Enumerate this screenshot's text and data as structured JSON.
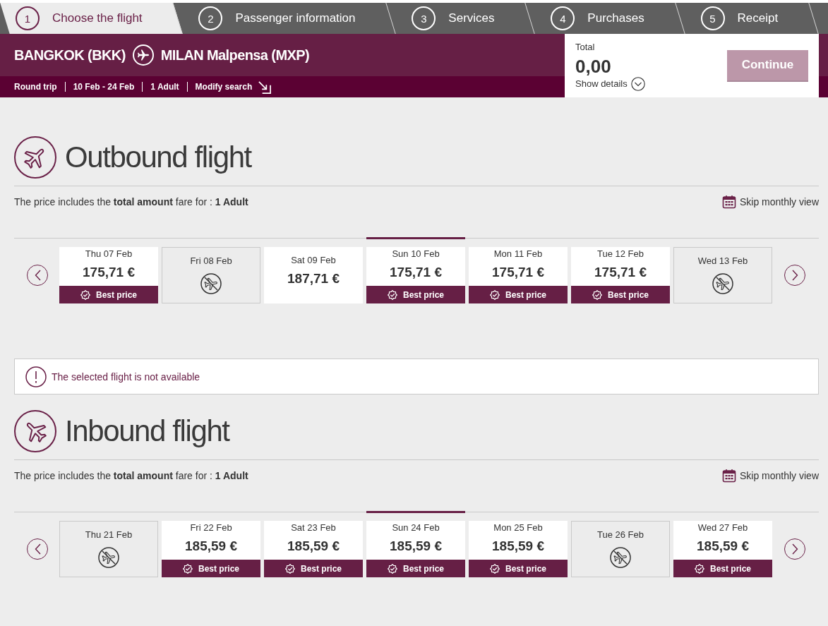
{
  "steps": [
    {
      "number": "1",
      "label": "Choose the flight",
      "selected": true
    },
    {
      "number": "2",
      "label": "Passenger information",
      "selected": false
    },
    {
      "number": "3",
      "label": "Services",
      "selected": false
    },
    {
      "number": "4",
      "label": "Purchases",
      "selected": false
    },
    {
      "number": "5",
      "label": "Receipt",
      "selected": false
    }
  ],
  "route": {
    "origin": "BANGKOK (BKK)",
    "destination": "MILAN Malpensa (MXP)"
  },
  "search_summary": [
    "Round trip",
    "10 Feb - 24 Feb",
    "1 Adult"
  ],
  "modify_search": "Modify search",
  "total": {
    "label": "Total",
    "amount": "0,00",
    "details_link": "Show details"
  },
  "continue_button": {
    "label": "Continue",
    "disabled": true
  },
  "outbound": {
    "title": "Outbound flight",
    "fare_note": "The price includes the **total amount** fare for : **1 Adult**",
    "skip_link": "Skip monthly view",
    "dates": [
      {
        "kind": "fare",
        "date": "Thu 07 Feb",
        "price": "175,71 €",
        "badge": "Best price",
        "selected": false
      },
      {
        "kind": "unavailable",
        "date": "Fri 08 Feb",
        "selected": false
      },
      {
        "kind": "fare",
        "date": "Sat 09 Feb",
        "price": "187,71 €",
        "selected": false
      },
      {
        "kind": "fare",
        "date": "Sun 10 Feb",
        "price": "175,71 €",
        "badge": "Best price",
        "selected": true
      },
      {
        "kind": "fare",
        "date": "Mon 11 Feb",
        "price": "175,71 €",
        "badge": "Best price",
        "selected": false
      },
      {
        "kind": "fare",
        "date": "Tue 12 Feb",
        "price": "175,71 €",
        "badge": "Best price",
        "selected": false
      },
      {
        "kind": "unavailable",
        "date": "Wed 13 Feb",
        "selected": false
      }
    ]
  },
  "alert": {
    "message": "The selected flight is not available"
  },
  "inbound": {
    "title": "Inbound flight",
    "fare_note": "The price includes the **total amount** fare for : **1 Adult**",
    "skip_link": "Skip monthly view",
    "dates": [
      {
        "kind": "unavailable",
        "date": "Thu 21 Feb",
        "selected": false
      },
      {
        "kind": "fare",
        "date": "Fri 22 Feb",
        "price": "185,59 €",
        "badge": "Best price",
        "selected": false
      },
      {
        "kind": "fare",
        "date": "Sat 23 Feb",
        "price": "185,59 €",
        "badge": "Best price",
        "selected": false
      },
      {
        "kind": "fare",
        "date": "Sun 24 Feb",
        "price": "185,59 €",
        "badge": "Best price",
        "selected": true
      },
      {
        "kind": "fare",
        "date": "Mon 25 Feb",
        "price": "185,59 €",
        "badge": "Best price",
        "selected": false
      },
      {
        "kind": "unavailable",
        "date": "Tue 26 Feb",
        "selected": false
      },
      {
        "kind": "fare",
        "date": "Wed 27 Feb",
        "price": "185,59 €",
        "badge": "Best price",
        "selected": false
      }
    ]
  }
}
